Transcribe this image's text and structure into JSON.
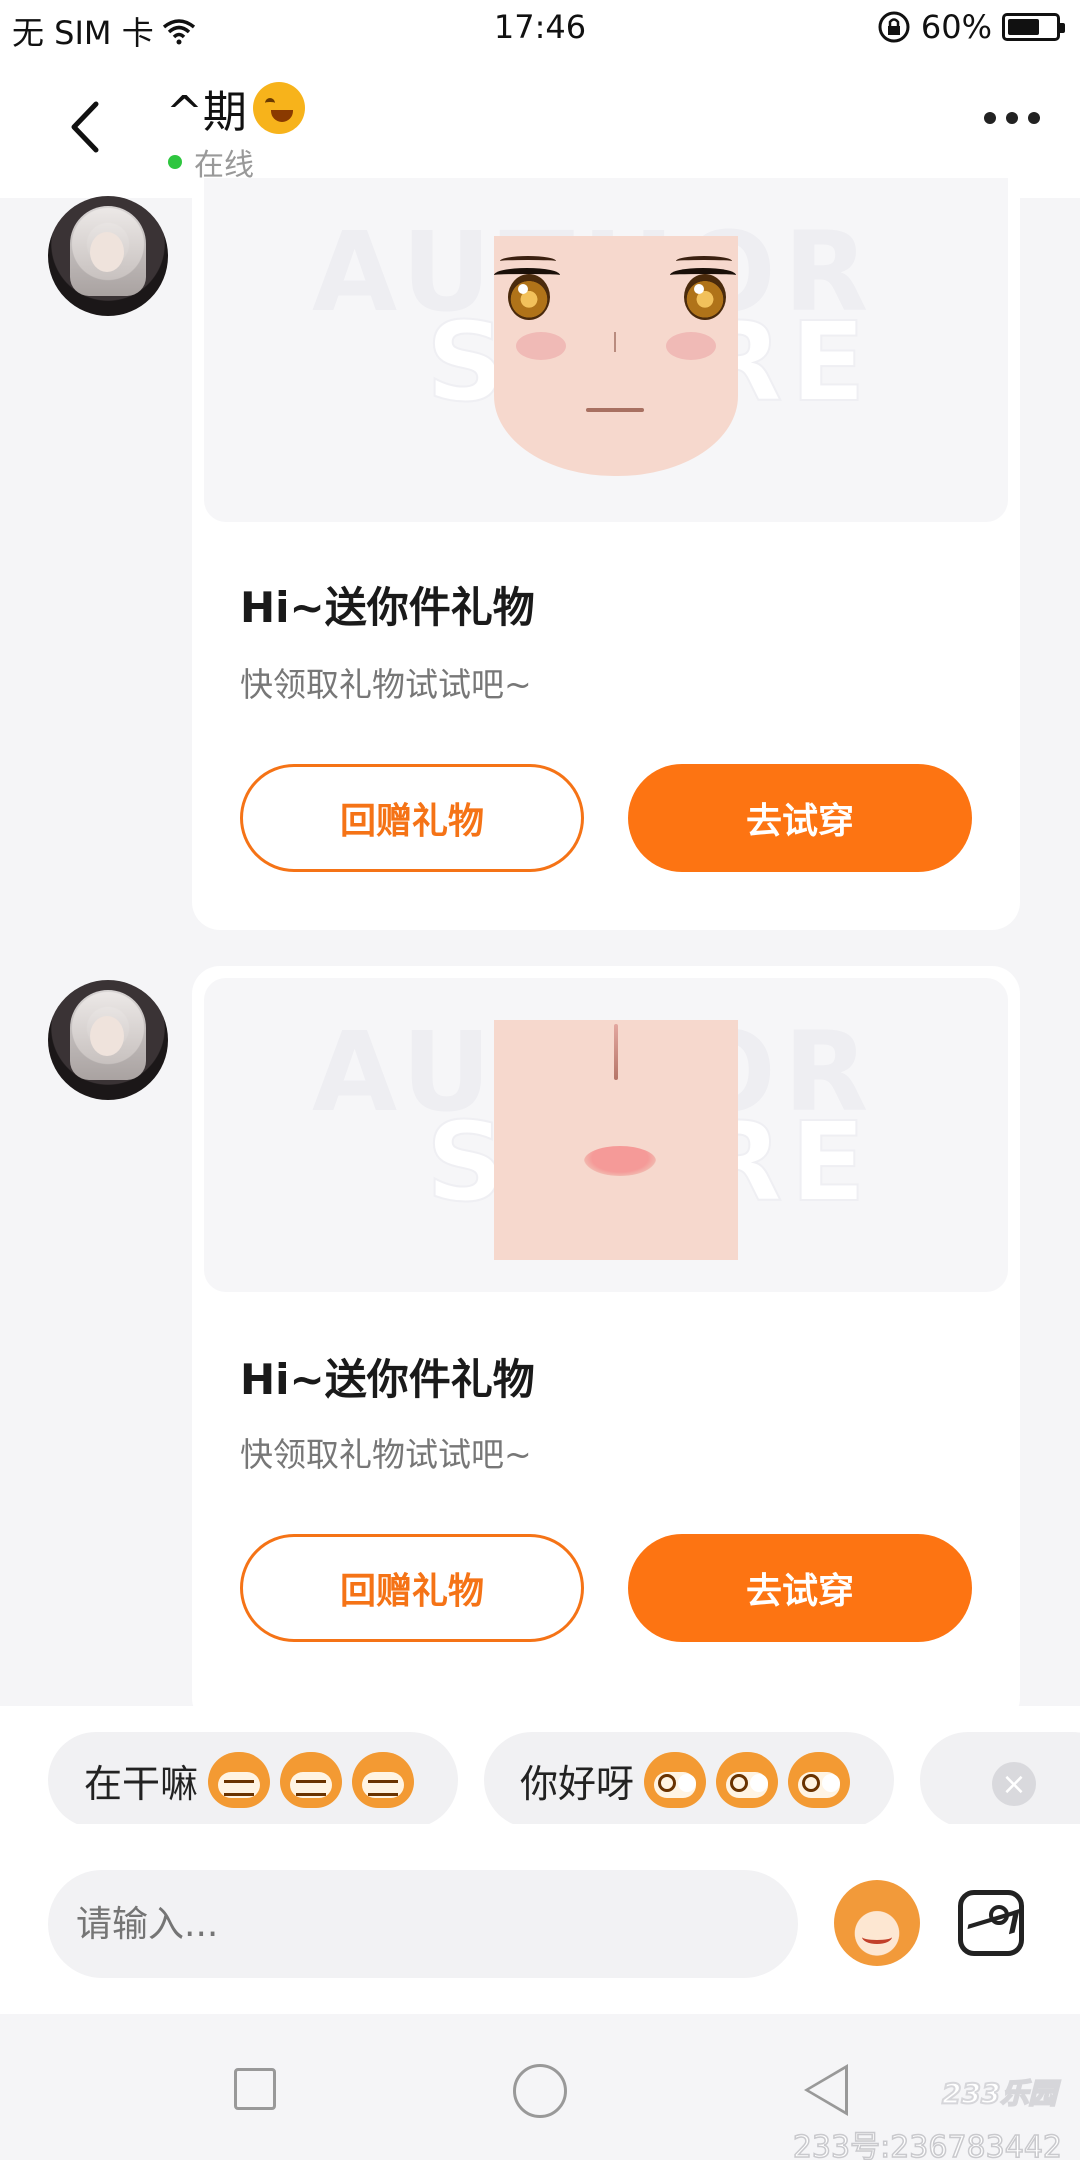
{
  "status_bar": {
    "carrier": "无 SIM 卡",
    "time": "17:46",
    "battery": "60%",
    "battery_level": 0.6
  },
  "header": {
    "name": "^期",
    "name_emoji": "laughing-face-emoji",
    "status": "在线"
  },
  "messages": [
    {
      "avatar": "avatar-image",
      "thumbnail": "face-texture-eyes",
      "watermark": [
        "AUTHOR",
        "STORE"
      ],
      "title": "Hi~送你件礼物",
      "subtitle": "快领取礼物试试吧~",
      "secondary_button": "回赠礼物",
      "primary_button": "去试穿"
    },
    {
      "avatar": "avatar-image",
      "thumbnail": "face-texture-lips",
      "watermark": [
        "AUTHOR",
        "STORE"
      ],
      "title": "Hi~送你件礼物",
      "subtitle": "快领取礼物试试吧~",
      "secondary_button": "回赠礼物",
      "primary_button": "去试穿"
    }
  ],
  "quick_replies": [
    {
      "text": "在干嘛",
      "emoji": "grinning-monkey-emoji"
    },
    {
      "text": "你好呀",
      "emoji": "wide-eyed-monkey-emoji"
    },
    {
      "text": "",
      "emoji": ""
    }
  ],
  "input": {
    "placeholder": "请输入..."
  },
  "nav": {
    "watermark_logo": "233乐园",
    "watermark_id": "233号:236783442"
  },
  "colors": {
    "accent": "#fd7412",
    "online": "#2ec63f",
    "background": "#f5f5f7"
  }
}
